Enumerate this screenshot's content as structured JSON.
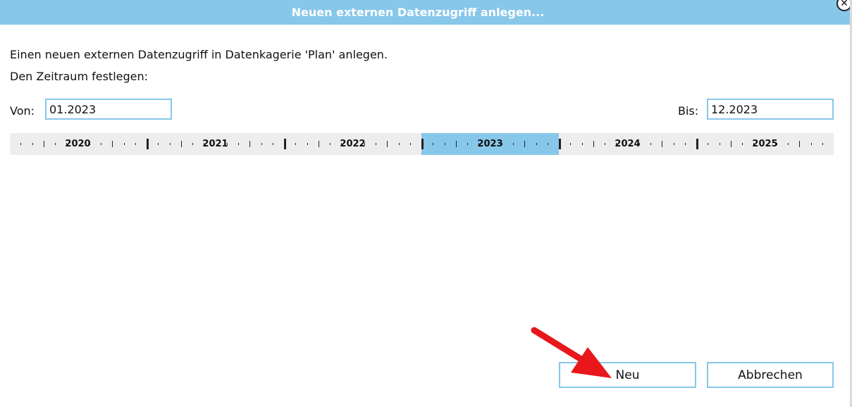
{
  "dialog": {
    "title": "Neuen externen Datenzugriff anlegen...",
    "description": "Einen neuen externen Datenzugriff in Datenkagerie 'Plan' anlegen.",
    "period_label": "Den Zeitraum festlegen:",
    "from_label": "Von:",
    "from_value": "01.2023",
    "to_label": "Bis:",
    "to_value": "12.2023"
  },
  "timeline": {
    "years": [
      "2020",
      "2021",
      "2022",
      "2023",
      "2024",
      "2025"
    ],
    "selected_year": "2023",
    "highlight_color": "#87c7ea"
  },
  "buttons": {
    "new_label": "Neu",
    "cancel_label": "Abbrechen"
  },
  "colors": {
    "accent": "#87c7ea",
    "arrow": "#e8171b"
  },
  "icons": {
    "close": "close-icon",
    "arrow": "red-arrow-annotation"
  }
}
